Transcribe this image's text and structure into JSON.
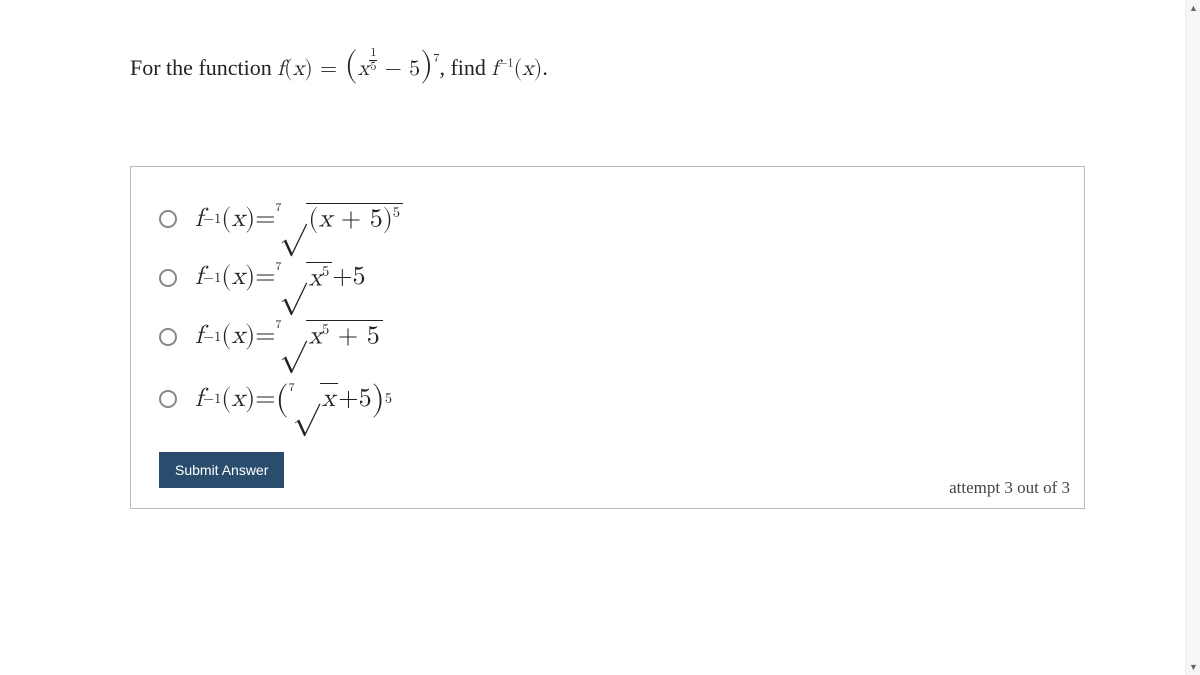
{
  "question": {
    "prefix": "For the function ",
    "f": "f",
    "lp": "(",
    "x": "x",
    "rp": ")",
    "eq": " = ",
    "big_lp": "(",
    "exp_num": "1",
    "exp_den": "5",
    "minus": " − ",
    "five": "5",
    "big_rp": ")",
    "outer_exp": "7",
    "comma": ", ",
    "find": "find ",
    "inv": "−1",
    "period": "."
  },
  "options": {
    "a": {
      "f": "f",
      "inv": "−1",
      "lp": "(",
      "x": "x",
      "rp": ")",
      "eq": " = ",
      "root_idx": "7",
      "rad_lp": "(",
      "rad_x": "x",
      "plus": " + ",
      "five": "5",
      "rad_rp": ")",
      "rad_exp": "5"
    },
    "b": {
      "f": "f",
      "inv": "−1",
      "lp": "(",
      "x": "x",
      "rp": ")",
      "eq": " = ",
      "root_idx": "7",
      "rad_x": "x",
      "rad_exp": "5",
      "plus": " + ",
      "five": "5"
    },
    "c": {
      "f": "f",
      "inv": "−1",
      "lp": "(",
      "x": "x",
      "rp": ")",
      "eq": " = ",
      "root_idx": "7",
      "rad_x": "x",
      "rad_exp": "5",
      "plus": " + ",
      "five": "5"
    },
    "d": {
      "f": "f",
      "inv": "−1",
      "lp": "(",
      "x": "x",
      "rp": ")",
      "eq": " = ",
      "big_lp": "(",
      "root_idx": "7",
      "rad_x": "x",
      "plus": " + ",
      "five": "5",
      "big_rp": ")",
      "outer_exp": "5"
    }
  },
  "submit_label": "Submit Answer",
  "attempt_text": "attempt 3 out of 3"
}
